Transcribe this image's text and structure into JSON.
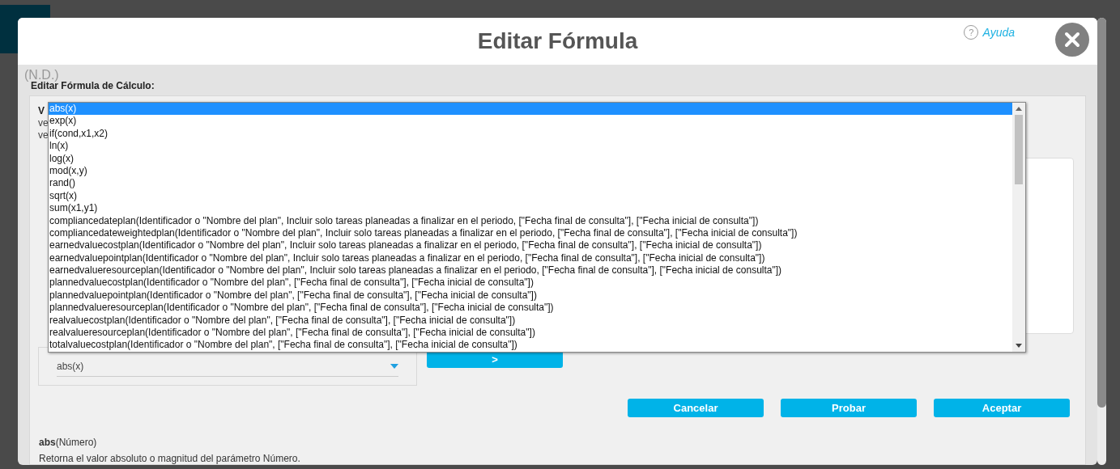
{
  "window": {
    "title": "Editar Fórmula"
  },
  "help_link": "Ayuda",
  "help_icon": "?",
  "background_badge": "(N.D.)",
  "section_label": "Editar Fórmula de Cálculo:",
  "variables_panel": {
    "heading": "V",
    "lines": [
      "ve",
      "ve"
    ]
  },
  "function_select": {
    "value": "abs(x)",
    "expanded": true,
    "options": [
      {
        "label": "abs(x)",
        "selected": true
      },
      {
        "label": "exp(x)",
        "selected": false
      },
      {
        "label": "if(cond,x1,x2)",
        "selected": false
      },
      {
        "label": "ln(x)",
        "selected": false
      },
      {
        "label": "log(x)",
        "selected": false
      },
      {
        "label": "mod(x,y)",
        "selected": false
      },
      {
        "label": "rand()",
        "selected": false
      },
      {
        "label": "sqrt(x)",
        "selected": false
      },
      {
        "label": "sum(x1,y1)",
        "selected": false
      },
      {
        "label": "compliancedateplan(Identificador o \"Nombre del plan\", Incluir solo tareas planeadas a finalizar en el periodo, [\"Fecha final de consulta\"], [\"Fecha inicial de consulta\"])",
        "selected": false
      },
      {
        "label": "compliancedateweightedplan(Identificador o \"Nombre del plan\", Incluir solo tareas planeadas a finalizar en el periodo, [\"Fecha final de consulta\"], [\"Fecha inicial de consulta\"])",
        "selected": false
      },
      {
        "label": "earnedvaluecostplan(Identificador o \"Nombre del plan\", Incluir solo tareas planeadas a finalizar en el periodo, [\"Fecha final de consulta\"], [\"Fecha inicial de consulta\"])",
        "selected": false
      },
      {
        "label": "earnedvaluepointplan(Identificador o \"Nombre del plan\", Incluir solo tareas planeadas a finalizar en el periodo, [\"Fecha final de consulta\"], [\"Fecha inicial de consulta\"])",
        "selected": false
      },
      {
        "label": "earnedvalueresourceplan(Identificador o \"Nombre del plan\", Incluir solo tareas planeadas a finalizar en el periodo, [\"Fecha final de consulta\"], [\"Fecha inicial de consulta\"])",
        "selected": false
      },
      {
        "label": "plannedvaluecostplan(Identificador o \"Nombre del plan\", [\"Fecha final de consulta\"], [\"Fecha inicial de consulta\"])",
        "selected": false
      },
      {
        "label": "plannedvaluepointplan(Identificador o \"Nombre del plan\", [\"Fecha final de consulta\"], [\"Fecha inicial de consulta\"])",
        "selected": false
      },
      {
        "label": "plannedvalueresourceplan(Identificador o \"Nombre del plan\", [\"Fecha final de consulta\"], [\"Fecha inicial de consulta\"])",
        "selected": false
      },
      {
        "label": "realvaluecostplan(Identificador o \"Nombre del plan\", [\"Fecha final de consulta\"], [\"Fecha inicial de consulta\"])",
        "selected": false
      },
      {
        "label": "realvalueresourceplan(Identificador o \"Nombre del plan\", [\"Fecha final de consulta\"], [\"Fecha inicial de consulta\"])",
        "selected": false
      },
      {
        "label": "totalvaluecostplan(Identificador o \"Nombre del plan\", [\"Fecha final de consulta\"], [\"Fecha inicial de consulta\"])",
        "selected": false
      }
    ]
  },
  "insert_button": ">",
  "buttons": [
    "Cancelar",
    "Probar",
    "Aceptar"
  ],
  "description": {
    "signature": "**abs**(Número)",
    "text": "Retorna el valor absoluto o magnitud del parámetro Número."
  }
}
